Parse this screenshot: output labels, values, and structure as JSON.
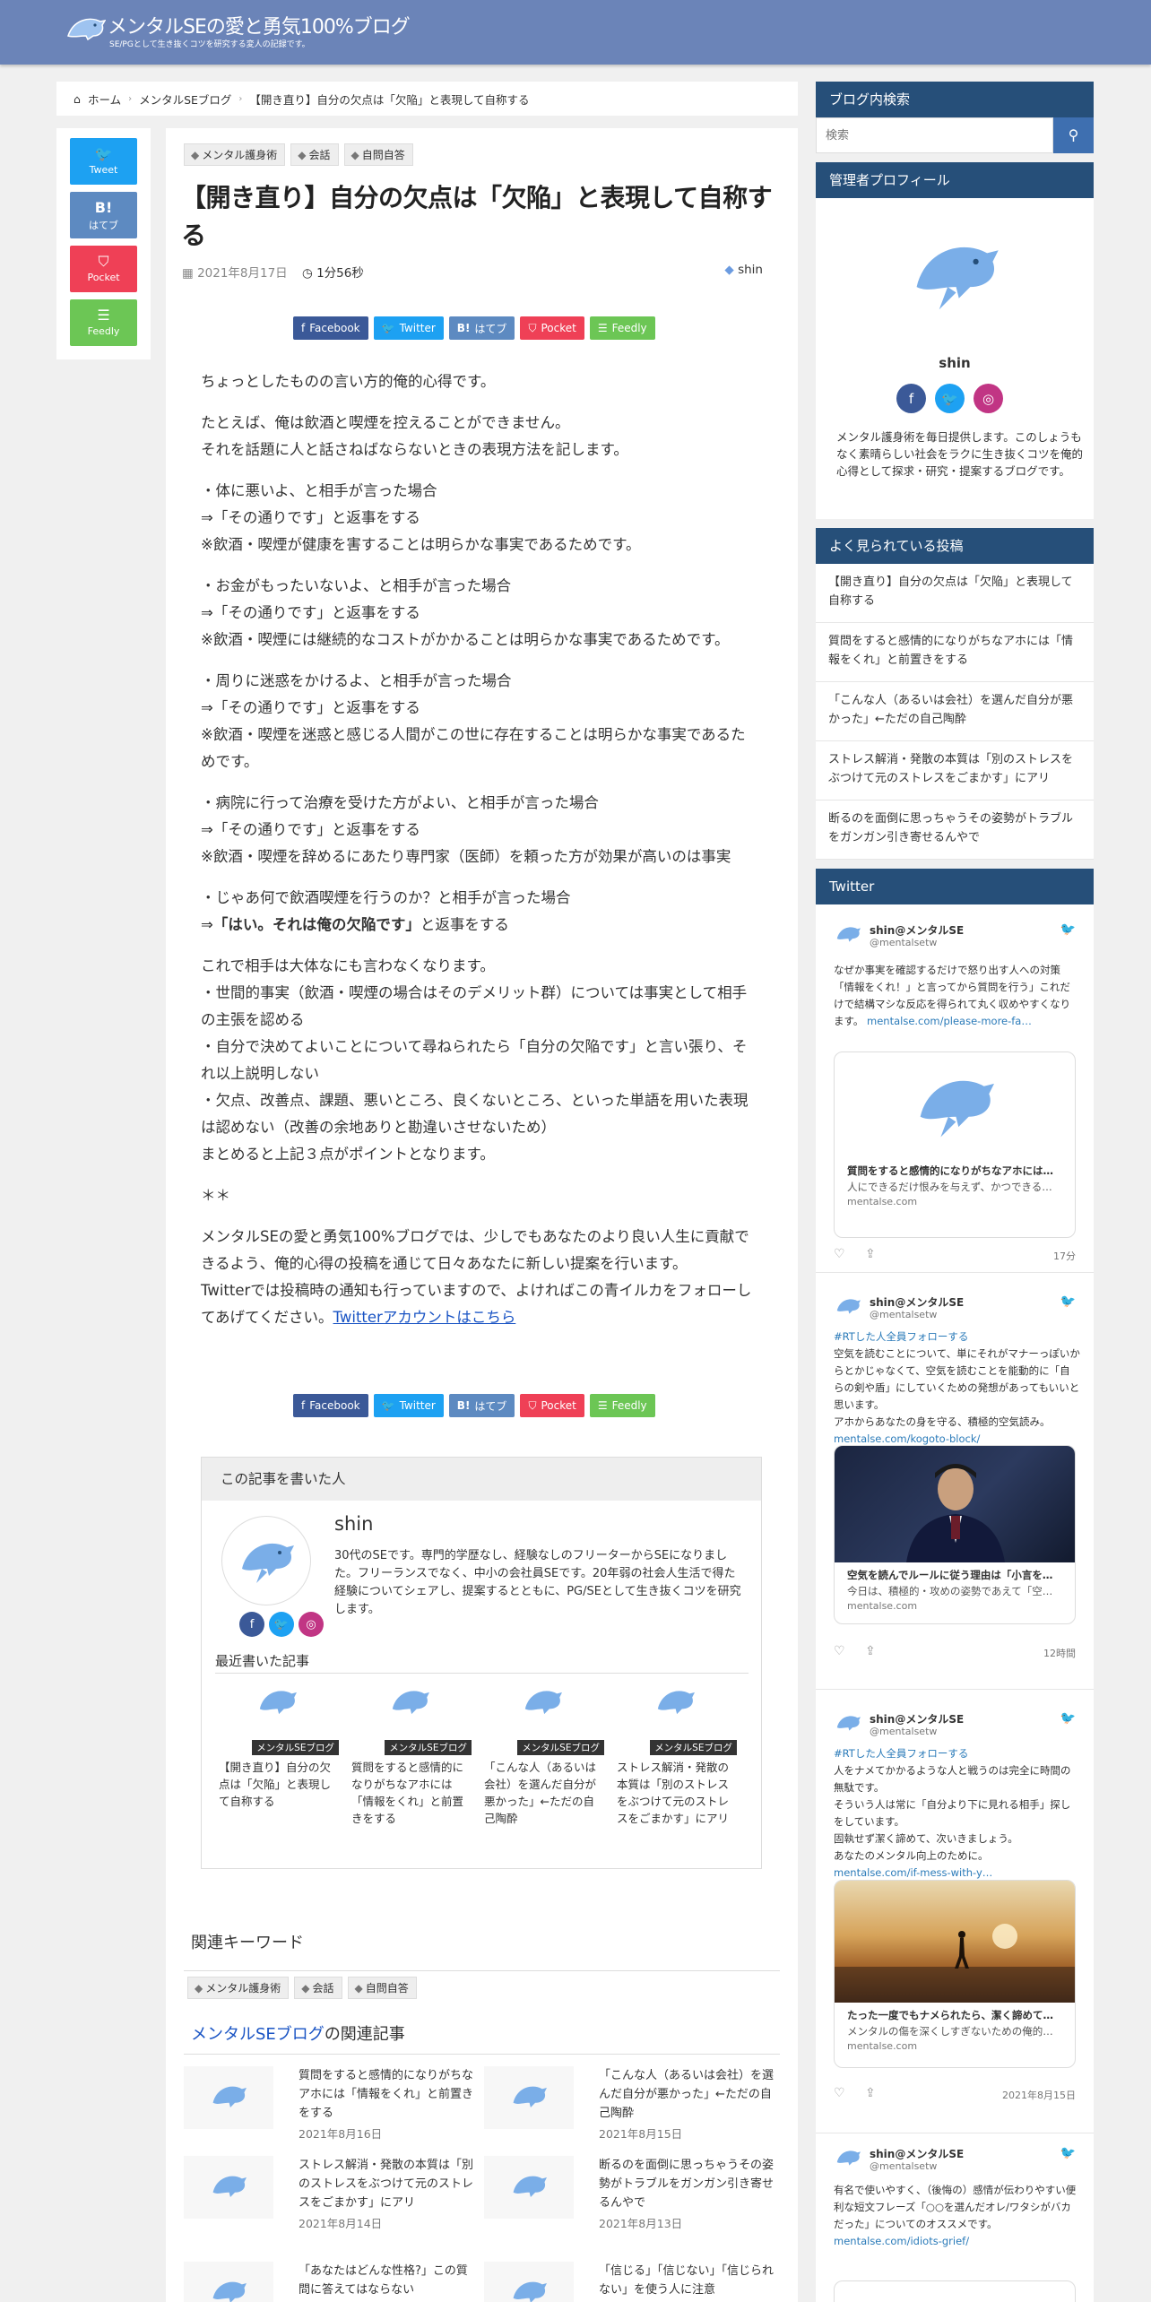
{
  "header": {
    "site_title": "メンタルSEの愛と勇気100%ブログ",
    "site_subtitle": "SE/PGとして生き抜くコツを研究する変人の記録です。"
  },
  "breadcrumb": {
    "home": "ホーム",
    "category": "メンタルSEブログ",
    "current": "【開き直り】自分の欠点は「欠陥」と表現して自称する"
  },
  "share_vertical": {
    "tweet": "Tweet",
    "hatena_icon": "B!",
    "hatena": "はてブ",
    "pocket": "Pocket",
    "feedly": "Feedly"
  },
  "article": {
    "categories": [
      "メンタル護身術",
      "会話",
      "自問自答"
    ],
    "title": "【開き直り】自分の欠点は「欠陥」と表現して自称する",
    "date": "2021年8月17日",
    "read_time": "1分56秒",
    "author": "shin",
    "body": {
      "p1": "ちょっとしたものの言い方的俺的心得です。",
      "p2a": "たとえば、俺は飲酒と喫煙を控えることができません。",
      "p2b": "それを話題に人と話さねばならないときの表現方法を記します。",
      "c1a": "・体に悪いよ、と相手が言った場合",
      "c1b": "⇒「その通りです」と返事をする",
      "c1c": "※飲酒・喫煙が健康を害することは明らかな事実であるためです。",
      "c2a": "・お金がもったいないよ、と相手が言った場合",
      "c2b": "⇒「その通りです」と返事をする",
      "c2c": "※飲酒・喫煙には継続的なコストがかかることは明らかな事実であるためです。",
      "c3a": "・周りに迷惑をかけるよ、と相手が言った場合",
      "c3b": "⇒「その通りです」と返事をする",
      "c3c": "※飲酒・喫煙を迷惑と感じる人間がこの世に存在することは明らかな事実であるためです。",
      "c4a": "・病院に行って治療を受けた方がよい、と相手が言った場合",
      "c4b": "⇒「その通りです」と返事をする",
      "c4c": "※飲酒・喫煙を辞めるにあたり専門家（医師）を頼った方が効果が高いのは事実",
      "c5a": "・じゃあ何で飲酒喫煙を行うのか？と相手が言った場合",
      "c5b_prefix": "⇒",
      "c5b_bold": "「はい。それは俺の欠陥です」",
      "c5b_suffix": "と返事をする",
      "s1": "これで相手は大体なにも言わなくなります。",
      "s2": "・世間的事実（飲酒・喫煙の場合はそのデメリット群）については事実として相手の主張を認める",
      "s3": "・自分で決めてよいことについて尋ねられたら「自分の欠陥です」と言い張り、それ以上説明しない",
      "s4": "・欠点、改善点、課題、悪いところ、良くないところ、といった単語を用いた表現は認めない（改善の余地ありと勘違いさせないため）",
      "s5": "まとめると上記３点がポイントとなります。",
      "stars": "＊＊",
      "f1": "メンタルSEの愛と勇気100%ブログでは、少しでもあなたのより良い人生に貢献できるよう、俺的心得の投稿を通じて日々あなたに新しい提案を行います。",
      "f2": "Twitterでは投稿時の通知も行っていますので、よければこの青イルカをフォローしてあげてください。",
      "f2_link": "Twitterアカウントはこちら"
    }
  },
  "share_buttons": {
    "facebook": "Facebook",
    "twitter": "Twitter",
    "hatena_icon": "B!",
    "hatena": "はてブ",
    "pocket": "Pocket",
    "feedly": "Feedly"
  },
  "author_box": {
    "heading": "この記事を書いた人",
    "name": "shin",
    "bio": "30代のSEです。専門的学歴なし、経験なしのフリーターからSEになりました。フリーランスでなく、中小の会社員SEです。20年弱の社会人生活で得た経験についてシェアし、提案するとともに、PG/SEとして生き抜くコツを研究します。",
    "recent_heading": "最近書いた記事",
    "recent": [
      {
        "badge": "メンタルSEブログ",
        "title": "【開き直り】自分の欠点は「欠陥」と表現して自称する"
      },
      {
        "badge": "メンタルSEブログ",
        "title": "質問をすると感情的になりがちなアホには「情報をくれ」と前置きをする"
      },
      {
        "badge": "メンタルSEブログ",
        "title": "「こんな人（あるいは会社）を選んだ自分が悪かった」←ただの自己陶酔"
      },
      {
        "badge": "メンタルSEブログ",
        "title": "ストレス解消・発散の本質は「別のストレスをぶつけて元のストレスをごまかす」にアリ"
      }
    ]
  },
  "keywords": {
    "heading": "関連キーワード",
    "tags": [
      "メンタル護身術",
      "会話",
      "自問自答"
    ]
  },
  "related": {
    "heading_link": "メンタルSEブログ",
    "heading_suffix": "の関連記事",
    "items": [
      {
        "title": "質問をすると感情的になりがちなアホには「情報をくれ」と前置きをする",
        "date": "2021年8月16日"
      },
      {
        "title": "「こんな人（あるいは会社）を選んだ自分が悪かった」←ただの自己陶酔",
        "date": "2021年8月15日"
      },
      {
        "title": "ストレス解消・発散の本質は「別のストレスをぶつけて元のストレスをごまかす」にアリ",
        "date": "2021年8月14日"
      },
      {
        "title": "断るのを面倒に思っちゃうその姿勢がトラブルをガンガン引き寄せるんやで",
        "date": "2021年8月13日"
      },
      {
        "title": "「あなたはどんな性格?」この質問に答えてはならない",
        "date": ""
      },
      {
        "title": "「信じる」「信じない」「信じられない」を使う人に注意",
        "date": ""
      }
    ]
  },
  "sidebar": {
    "search": {
      "heading": "ブログ内検索",
      "placeholder": "検索"
    },
    "profile": {
      "heading": "管理者プロフィール",
      "name": "shin",
      "desc": "メンタル護身術を毎日提供します。このしょうもなく素晴らしい社会をラクに生き抜くコツを俺的心得として探求・研究・提案するブログです。"
    },
    "popular": {
      "heading": "よく見られている投稿",
      "items": [
        "【開き直り】自分の欠点は「欠陥」と表現して自称する",
        "質問をすると感情的になりがちなアホには「情報をくれ」と前置きをする",
        "「こんな人（あるいは会社）を選んだ自分が悪かった」←ただの自己陶酔",
        "ストレス解消・発散の本質は「別のストレスをぶつけて元のストレスをごまかす」にアリ",
        "断るのを面倒に思っちゃうその姿勢がトラブルをガンガン引き寄せるんやで"
      ]
    },
    "twitter": {
      "heading": "Twitter",
      "tweets": [
        {
          "name": "shin@メンタルSE",
          "handle": "@mentalsetw",
          "text": "なぜか事実を確認するだけで怒り出す人への対策「情報をくれ！」と言ってから質問を行う」これだけで結構マシな反応を得られて丸く収めやすくなります。",
          "link": "mentalse.com/please-more-fa…",
          "card_title": "質問をすると感情的になりがちなアホには…",
          "card_desc": "人にできるだけ恨みを与えず、かつできる…",
          "card_url": "mentalse.com",
          "time": "17分"
        },
        {
          "name": "shin@メンタルSE",
          "handle": "@mentalsetw",
          "hashtag": "#RTした人全員フォローする",
          "text": "空気を読むことについて、単にそれがマナーっぽいからとかじゃなくて、空気を読むことを能動的に「自らの剣や盾」にしていくための発想があってもいいと思います。\nアホからあなたの身を守る、積極的空気読み。",
          "link": "mentalse.com/kogoto-block/",
          "card_title": "空気を読んでルールに従う理由は「小言を…",
          "card_desc": "今日は、積極的・攻めの姿勢であえて「空…",
          "card_url": "mentalse.com",
          "time": "12時間"
        },
        {
          "name": "shin@メンタルSE",
          "handle": "@mentalsetw",
          "hashtag": "#RTした人全員フォローする",
          "text": "人をナメてかかるような人と戦うのは完全に時間の無駄です。\nそういう人は常に「自分より下に見れる相手」探しをしています。\n固執せず潔く諦めて、次いきましょう。\nあなたのメンタル向上のために。",
          "link": "mentalse.com/if-mess-with-y…",
          "card_title": "たった一度でもナメられたら、潔く諦めて…",
          "card_desc": "メンタルの傷を深くしすぎないための俺的…",
          "card_url": "mentalse.com",
          "time": "2021年8月15日"
        },
        {
          "name": "shin@メンタルSE",
          "handle": "@mentalsetw",
          "text": "有名で使いやすく、（後悔の）感情が伝わりやすい便利な短文フレーズ「○○を選んだオレ/ワタシがバカだった」についてのオススメです。",
          "link": "mentalse.com/idiots-grief/"
        }
      ]
    }
  },
  "colors": {
    "header": "#6b84b8",
    "sidebar_heading": "#264f79",
    "twitter": "#1da1f2",
    "facebook": "#3b5998",
    "hatena": "#5d8ac1",
    "pocket": "#ef4056",
    "feedly": "#6cc655",
    "instagram": "#c13584"
  }
}
